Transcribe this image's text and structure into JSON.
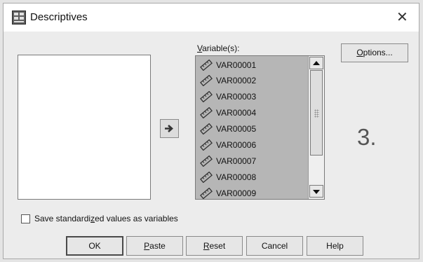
{
  "window": {
    "title": "Descriptives",
    "close_glyph": "✕",
    "icon": "spss-dialog-icon"
  },
  "variables": {
    "label": "Variable(s):",
    "items": [
      "VAR00001",
      "VAR00002",
      "VAR00003",
      "VAR00004",
      "VAR00005",
      "VAR00006",
      "VAR00007",
      "VAR00008",
      "VAR00009"
    ],
    "item_icon": "scale-ruler-icon"
  },
  "options_button": "Options...",
  "step_number": "3.",
  "checkbox": {
    "label": "Save standardized values as variables",
    "checked": false
  },
  "buttons": {
    "ok": "OK",
    "paste": "Paste",
    "reset": "Reset",
    "cancel": "Cancel",
    "help": "Help"
  },
  "colors": {
    "selected_list_bg": "#b6b6b6",
    "dialog_bg": "#ececec"
  }
}
